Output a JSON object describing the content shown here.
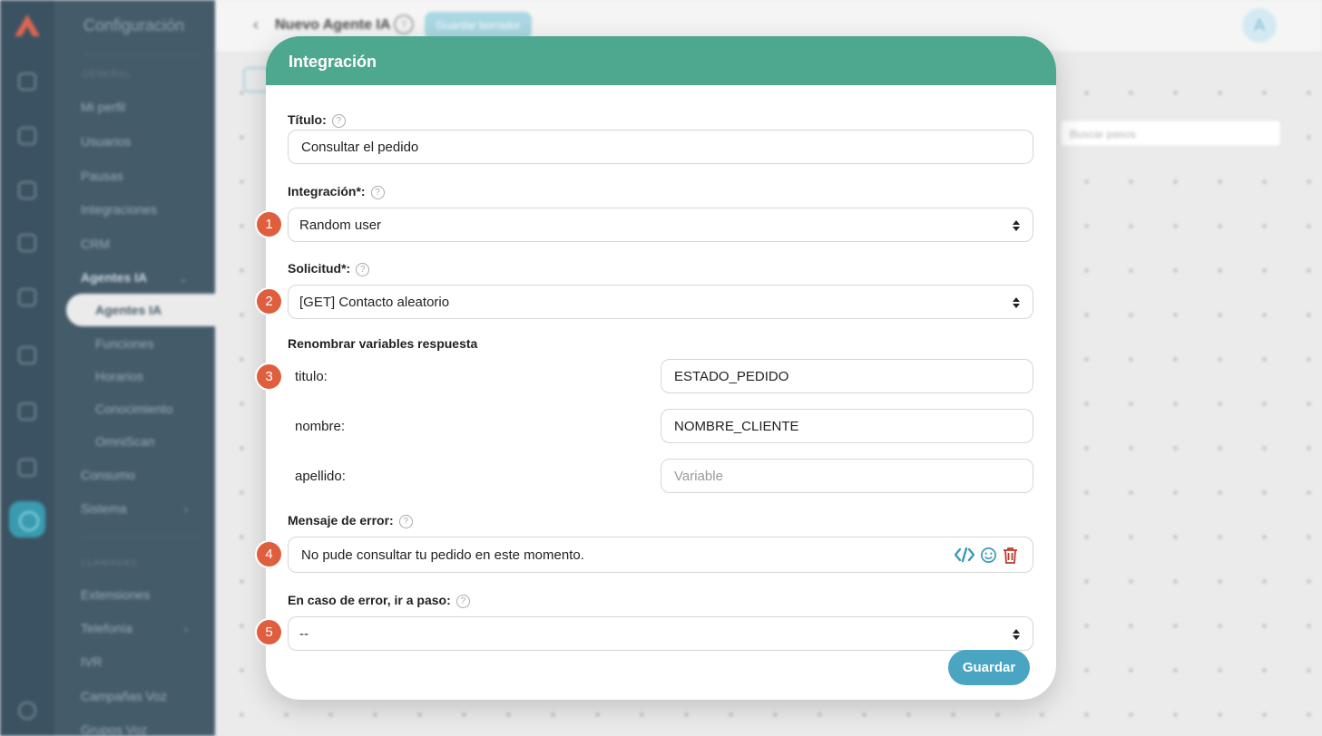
{
  "background": {
    "sidebar": {
      "title": "Configuración",
      "section_general": "GENERAL",
      "items": [
        "Mi perfil",
        "Usuarios",
        "Pausas",
        "Integraciones",
        "CRM",
        "Agentes IA"
      ],
      "subitems": [
        "Agentes IA",
        "Funciones",
        "Horarios",
        "Conocimiento",
        "OmniScan"
      ],
      "items_after": [
        "Consumo",
        "Sistema"
      ],
      "section_llamadas": "LLAMADAS",
      "items_calls": [
        "Extensiones",
        "Telefonía",
        "IVR",
        "Campañas Voz",
        "Grupos Voz"
      ]
    },
    "topbar": {
      "title": "Nuevo Agente IA",
      "help": "?",
      "save_label": "Guardar borrador",
      "avatar": "A"
    },
    "search_placeholder": "Buscar pasos"
  },
  "modal": {
    "title": "Integración",
    "titulo_label": "Título:",
    "titulo_value": "Consultar el pedido",
    "integracion_label": "Integración*:",
    "integracion_value": "Random user",
    "solicitud_label": "Solicitud*:",
    "solicitud_value": "[GET] Contacto aleatorio",
    "rename_label": "Renombrar variables respuesta",
    "variables": [
      {
        "name": "titulo:",
        "value": "ESTADO_PEDIDO",
        "placeholder": ""
      },
      {
        "name": "nombre:",
        "value": "NOMBRE_CLIENTE",
        "placeholder": ""
      },
      {
        "name": "apellido:",
        "value": "",
        "placeholder": "Variable"
      }
    ],
    "error_label": "Mensaje de error:",
    "error_value": "No pude consultar tu pedido en este momento.",
    "goto_label": "En caso de error, ir a paso:",
    "goto_value": "--",
    "save_label": "Guardar",
    "help_glyph": "?"
  },
  "steps": [
    "1",
    "2",
    "3",
    "4",
    "5"
  ],
  "colors": {
    "header": "#4ea78f",
    "step": "#df5e3e",
    "save": "#4aa5c3",
    "code_icon": "#3a9bb8",
    "delete_icon": "#c0392b"
  }
}
